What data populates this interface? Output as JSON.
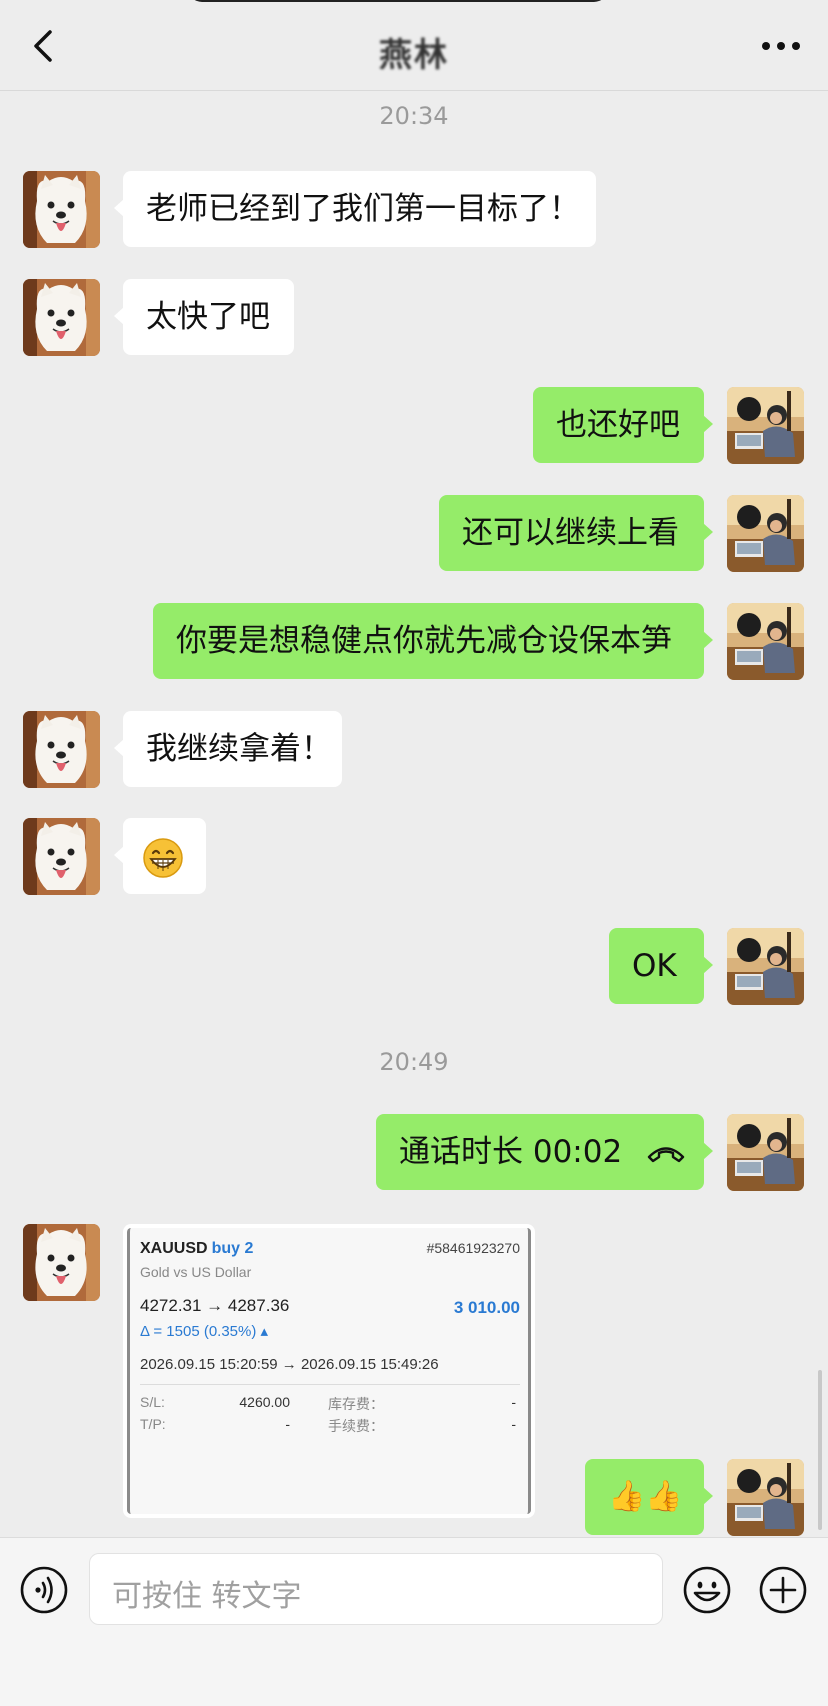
{
  "header": {
    "title": "燕林"
  },
  "messages": {
    "time1": "20:34",
    "m1": "老师已经到了我们第一目标了！",
    "m2": "太快了吧",
    "m3": "也还好吧",
    "m4": "还可以继续上看",
    "m5": "你要是想稳健点你就先减仓设保本笋",
    "m6": "我继续拿着！",
    "m8": "OK",
    "time2": "20:49",
    "call": "通话时长 00:02",
    "thumbs": "👍👍"
  },
  "trade_card": {
    "symbol": "XAUUSD",
    "side": "buy 2",
    "ticket": "#58461923270",
    "description": "Gold vs US Dollar",
    "prices": "4272.31 → 4287.36",
    "profit": "3 010.00",
    "delta": "Δ = 1505 (0.35%) ▴",
    "dates": "2026.09.15 15:20:59 → 2026.09.15 15:49:26",
    "sl_label": "S/L:",
    "sl_value": "4260.00",
    "tp_label": "T/P:",
    "tp_value": "-",
    "swap_label": "库存费：",
    "swap_value": "-",
    "commission_label": "手续费：",
    "commission_value": "-"
  },
  "input_bar": {
    "placeholder": "可按住 转文字"
  },
  "colors": {
    "sent_bubble": "#95ec69",
    "received_bubble": "#ffffff",
    "background": "#ededed",
    "accent_blue": "#2a7ad2"
  },
  "icons": {
    "back": "chevron-left-icon",
    "more": "more-dots-icon",
    "voice": "voice-icon",
    "emoji": "emoji-icon",
    "plus": "plus-icon",
    "call": "phone-hangup-icon",
    "grin": "grin-emoji-icon"
  }
}
